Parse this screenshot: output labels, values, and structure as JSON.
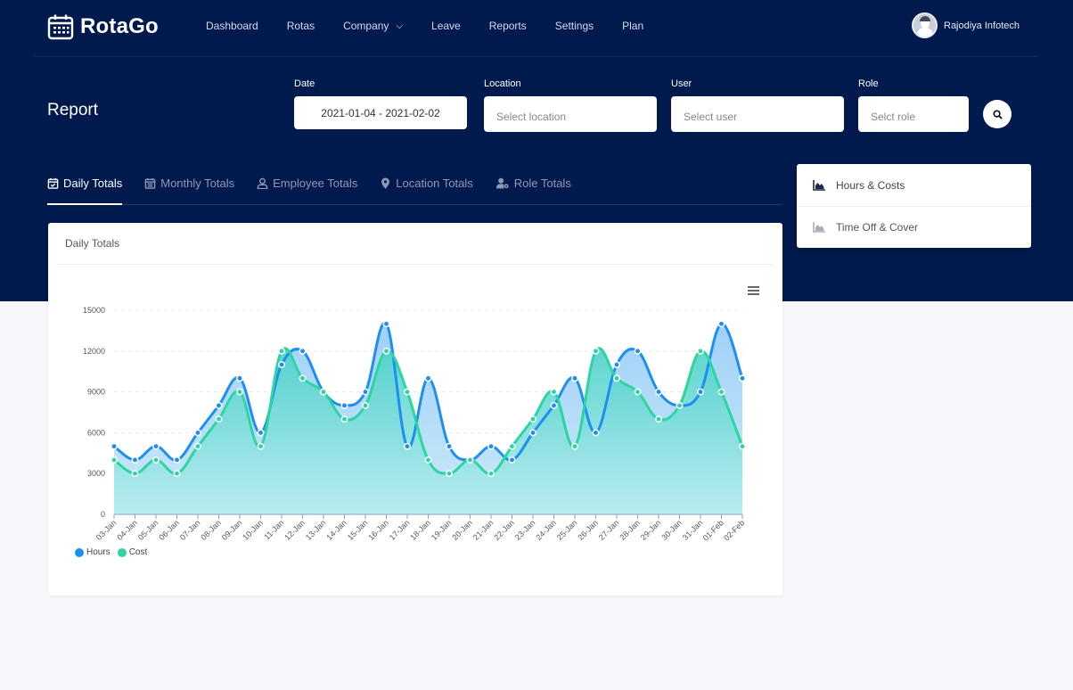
{
  "app": {
    "name": "RotaGo",
    "logo_icon": "calendar-icon"
  },
  "nav": {
    "items": [
      {
        "label": "Dashboard"
      },
      {
        "label": "Rotas"
      },
      {
        "label": "Company",
        "has_dropdown": true
      },
      {
        "label": "Leave"
      },
      {
        "label": "Reports"
      },
      {
        "label": "Settings"
      },
      {
        "label": "Plan"
      }
    ]
  },
  "user": {
    "name": "Rajodiya Infotech"
  },
  "page": {
    "title": "Report"
  },
  "filters": {
    "date": {
      "label": "Date",
      "value": "2021-01-04 - 2021-02-02"
    },
    "location": {
      "label": "Location",
      "placeholder": "Select location"
    },
    "user": {
      "label": "User",
      "placeholder": "Select user"
    },
    "role": {
      "label": "Role",
      "placeholder": "Selct role"
    },
    "search_icon": "search-icon"
  },
  "tabs": [
    {
      "label": "Daily Totals",
      "icon": "calendar-check-icon",
      "active": true
    },
    {
      "label": "Monthly Totals",
      "icon": "calendar-icon",
      "active": false
    },
    {
      "label": "Employee Totals",
      "icon": "user-icon",
      "active": false
    },
    {
      "label": "Location Totals",
      "icon": "map-pin-icon",
      "active": false
    },
    {
      "label": "Role Totals",
      "icon": "user-cog-icon",
      "active": false
    }
  ],
  "side_menu": [
    {
      "label": "Hours & Costs",
      "icon": "area-chart-icon",
      "active": true
    },
    {
      "label": "Time Off & Cover",
      "icon": "area-chart-icon",
      "active": false
    }
  ],
  "card": {
    "title": "Daily Totals"
  },
  "colors": {
    "header_bg": "#001a4d",
    "hours": "#1f8ef1",
    "cost": "#2dd6a0"
  },
  "chart_data": {
    "type": "area",
    "title": "Daily Totals",
    "xlabel": "",
    "ylabel": "",
    "ylim": [
      0,
      15000
    ],
    "yticks": [
      0,
      3000,
      6000,
      9000,
      12000,
      15000
    ],
    "grid": true,
    "legend": "bottom-left",
    "categories": [
      "03-Jan",
      "04-Jan",
      "05-Jan",
      "06-Jan",
      "07-Jan",
      "08-Jan",
      "09-Jan",
      "10-Jan",
      "11-Jan",
      "12-Jan",
      "13-Jan",
      "14-Jan",
      "15-Jan",
      "16-Jan",
      "17-Jan",
      "18-Jan",
      "19-Jan",
      "20-Jan",
      "21-Jan",
      "22-Jan",
      "23-Jan",
      "24-Jan",
      "25-Jan",
      "26-Jan",
      "27-Jan",
      "28-Jan",
      "29-Jan",
      "30-Jan",
      "31-Jan",
      "01-Feb",
      "02-Feb"
    ],
    "series": [
      {
        "name": "Hours",
        "color": "#1f8ef1",
        "values": [
          5000,
          4000,
          5000,
          4000,
          6000,
          8000,
          10000,
          6000,
          11000,
          12000,
          9000,
          8000,
          9000,
          14000,
          5000,
          10000,
          5000,
          4000,
          5000,
          4000,
          6000,
          8000,
          10000,
          6000,
          11000,
          12000,
          9000,
          8000,
          9000,
          14000,
          10000
        ]
      },
      {
        "name": "Cost",
        "color": "#2dd6a0",
        "values": [
          4000,
          3000,
          4000,
          3000,
          5000,
          7000,
          9000,
          5000,
          12000,
          10000,
          9000,
          7000,
          8000,
          12000,
          9000,
          4000,
          3000,
          4000,
          3000,
          5000,
          7000,
          9000,
          5000,
          12000,
          10000,
          9000,
          7000,
          8000,
          12000,
          9000,
          5000
        ]
      }
    ]
  }
}
